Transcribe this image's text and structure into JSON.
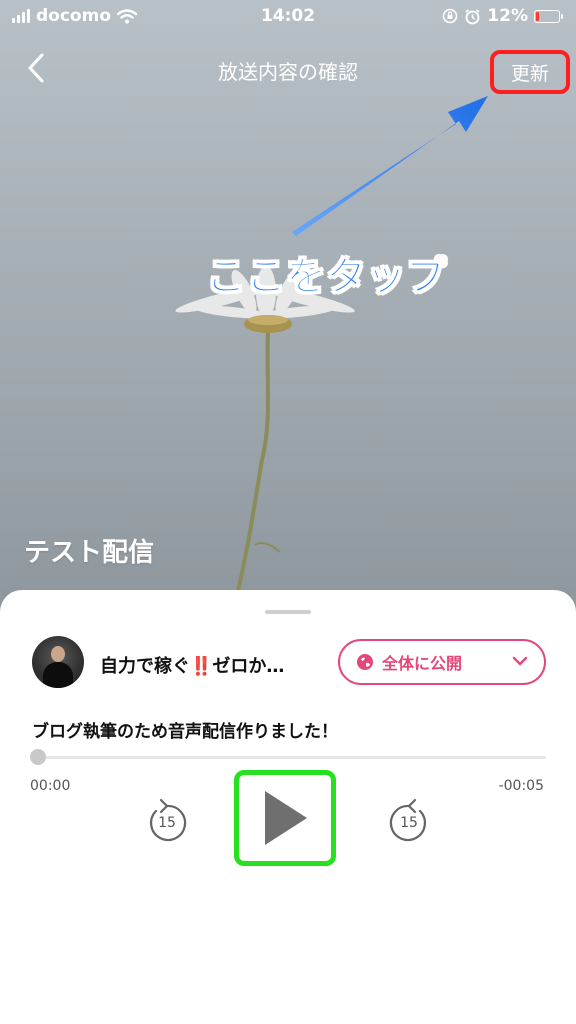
{
  "status_bar": {
    "carrier": "docomo",
    "time": "14:02",
    "battery": "12%"
  },
  "nav": {
    "title": "放送内容の確認",
    "update_label": "更新"
  },
  "annotation": {
    "text": "ここをタップ"
  },
  "hero": {
    "title": "テスト配信"
  },
  "channel": {
    "name_prefix": "自力で稼ぐ",
    "name_emoji": "‼️",
    "name_suffix": "ゼロか…"
  },
  "visibility": {
    "label": "全体に公開"
  },
  "episode": {
    "description": "ブログ執筆のため音声配信作りました！"
  },
  "player": {
    "progress": 0,
    "elapsed": "00:00",
    "remaining": "-00:05",
    "skip_back_seconds": "15",
    "skip_forward_seconds": "15"
  },
  "colors": {
    "accent_pink": "#e4487a",
    "highlight_red": "#ff1e1e",
    "highlight_green": "#27e020",
    "annotation_blue": "#2d7bf2"
  }
}
